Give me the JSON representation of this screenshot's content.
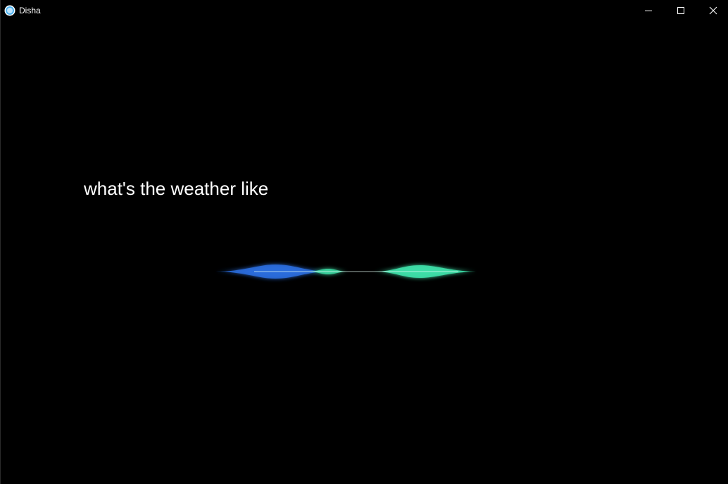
{
  "window": {
    "title": "Disha",
    "app_icon": "assistant-orb-icon",
    "controls": {
      "minimize_icon": "minimize-icon",
      "maximize_icon": "maximize-icon",
      "close_icon": "close-icon"
    }
  },
  "assistant": {
    "query": "what's the weather like",
    "waveform_colors": {
      "blue": "#2a6fe0",
      "green": "#3ee0a8",
      "line": "#cfe8ff"
    }
  }
}
